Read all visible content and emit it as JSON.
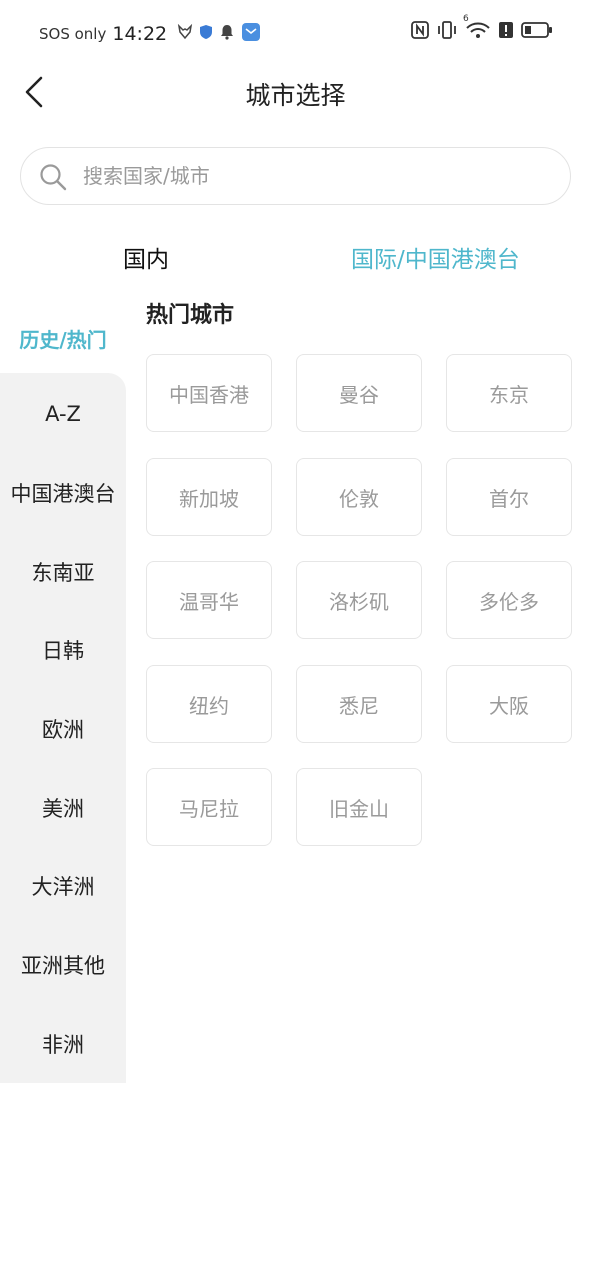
{
  "status_bar": {
    "carrier": "SOS only",
    "time": "14:22",
    "icons_left": [
      "fox-icon",
      "shield-icon",
      "bell-icon",
      "app-mail-icon"
    ],
    "icons_right": [
      "nfc-icon",
      "vibrate-icon",
      "wifi-icon",
      "alert-icon",
      "battery-icon"
    ],
    "wifi_badge": "6"
  },
  "header": {
    "title": "城市选择",
    "back_icon": "chevron-left-icon"
  },
  "search": {
    "placeholder": "搜索国家/城市",
    "value": ""
  },
  "tabs": [
    {
      "label": "国内",
      "active": false
    },
    {
      "label": "国际/中国港澳台",
      "active": true
    }
  ],
  "sidebar": {
    "active_label": "历史/热门",
    "items": [
      {
        "label": "A-Z"
      },
      {
        "label": "中国港澳台"
      },
      {
        "label": "东南亚"
      },
      {
        "label": "日韩"
      },
      {
        "label": "欧洲"
      },
      {
        "label": "美洲"
      },
      {
        "label": "大洋洲"
      },
      {
        "label": "亚洲其他"
      },
      {
        "label": "非洲"
      }
    ]
  },
  "hot_cities": {
    "title": "热门城市",
    "cities": [
      "中国香港",
      "曼谷",
      "东京",
      "新加坡",
      "伦敦",
      "首尔",
      "温哥华",
      "洛杉矶",
      "多伦多",
      "纽约",
      "悉尼",
      "大阪",
      "马尼拉",
      "旧金山"
    ]
  },
  "colors": {
    "accent": "#4fb7cc",
    "sidebar_bg": "#f2f2f2",
    "city_text": "#9a9a9a"
  }
}
